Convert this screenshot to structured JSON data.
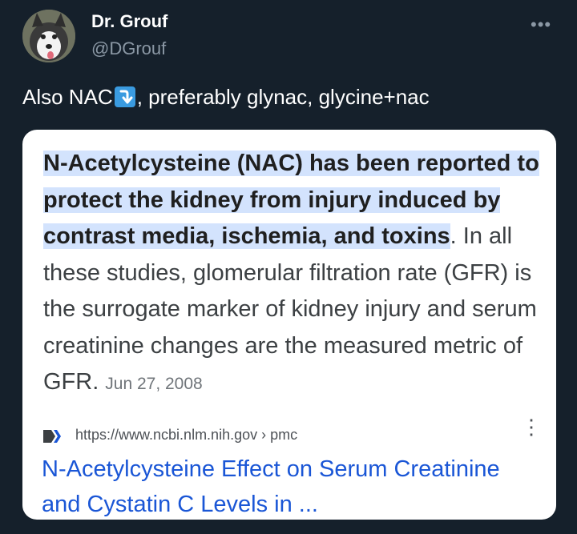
{
  "author": {
    "name": "Dr. Grouf",
    "handle": "@DGrouf",
    "more_glyph": "•••"
  },
  "tweet": {
    "text_before": "Also NAC",
    "arrow_icon": "arrow-down-right-icon",
    "text_after": ", preferably glynac, glycine+nac"
  },
  "card": {
    "highlight": "N-Acetylcysteine (NAC) has been reported to protect the kidney from injury induced by contrast media, ischemia, and toxins",
    "rest": ". In all these studies, glomerular filtration rate (GFR) is the surrogate marker of kidney injury and serum creatinine changes are the measured metric of GFR.",
    "date": "Jun 27, 2008",
    "source_url": "https://www.ncbi.nlm.nih.gov › pmc",
    "source_menu": "⋮",
    "title": "N-Acetylcysteine Effect on Serum Creatinine and Cystatin C Levels in ..."
  },
  "colors": {
    "background": "#15202b",
    "highlight": "#d3e3fd",
    "link": "#1a56d6",
    "badge": "#3a9be0"
  }
}
